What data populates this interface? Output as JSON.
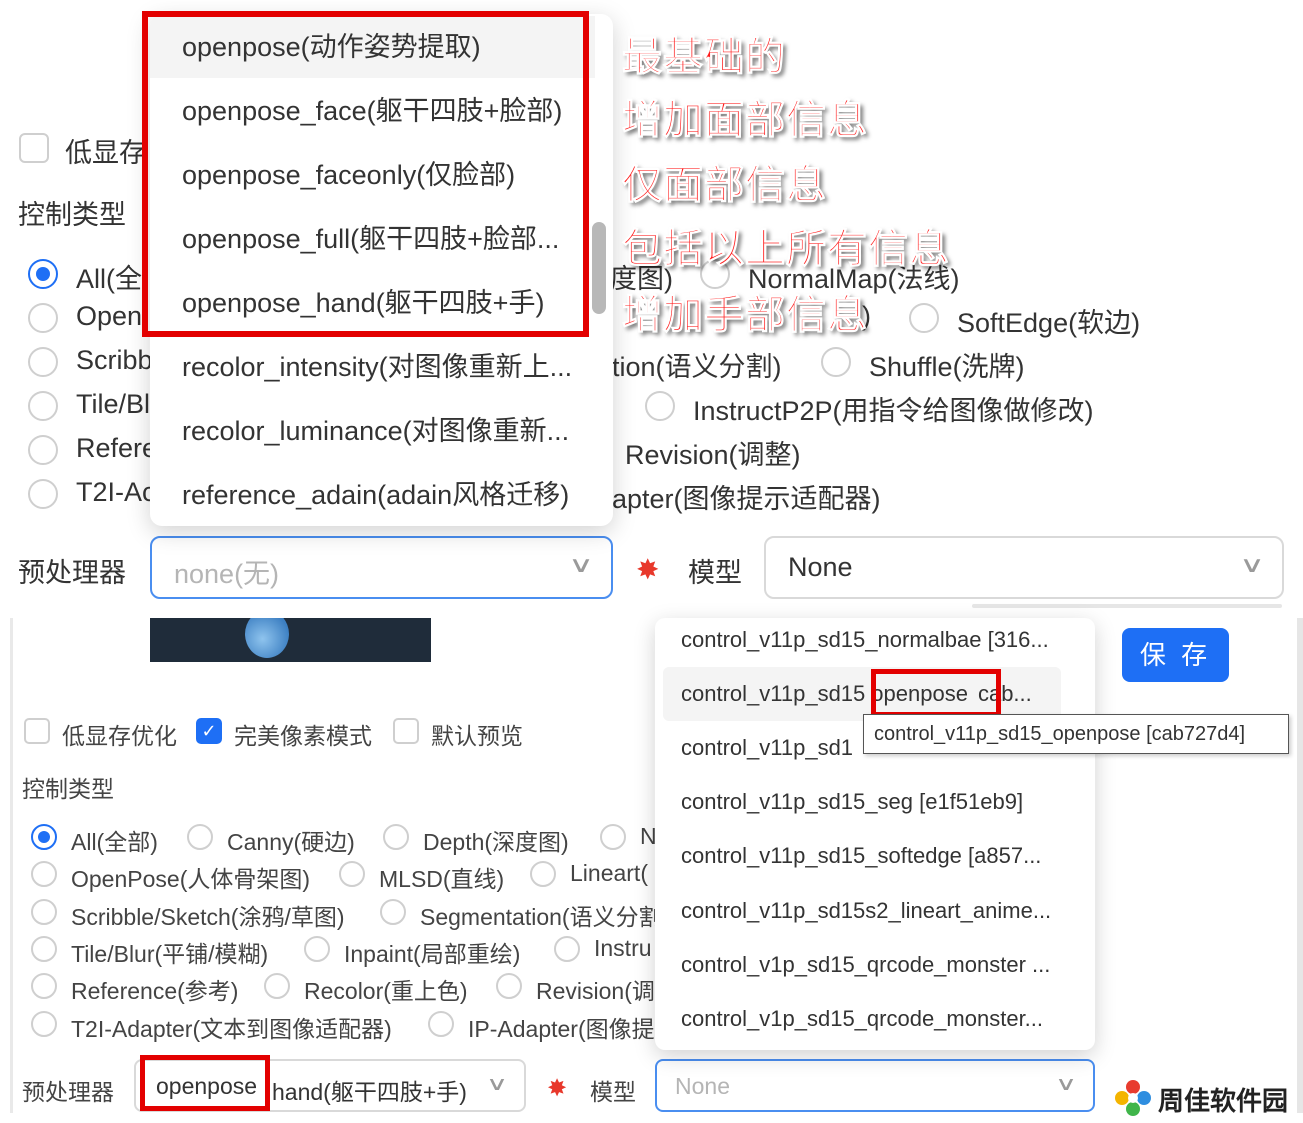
{
  "top": {
    "low_vram_label": "低显存",
    "control_type_label": "控制类型",
    "radios_left": [
      "All(全",
      "Open",
      "Scribb",
      "Tile/Bl",
      "Refere",
      "T2I-Ac"
    ],
    "radios_right": {
      "row1_prefix": "度图)",
      "row1_item": "NormalMap(法线)",
      "row2_prefix": ")",
      "row2_item": "SoftEdge(软边)",
      "row3_prefix": "tion(语义分割)",
      "row3_item": "Shuffle(洗牌)",
      "row4_item": "InstructP2P(用指令给图像做修改)",
      "row5_item": "Revision(调整)",
      "row6_prefix": "apter(图像提示适配器)"
    },
    "preprocessor_label": "预处理器",
    "preprocessor_value": "none(无)",
    "model_label": "模型",
    "model_value": "None",
    "dropdown_items": [
      "openpose(动作姿势提取)",
      "openpose_face(躯干四肢+脸部)",
      "openpose_faceonly(仅脸部)",
      "openpose_full(躯干四肢+脸部...",
      "openpose_hand(躯干四肢+手)",
      "recolor_intensity(对图像重新上...",
      "recolor_luminance(对图像重新...",
      "reference_adain(adain风格迁移)"
    ],
    "notes": [
      "最基础的",
      "增加面部信息",
      "仅面部信息",
      "包括以上所有信息",
      "增加手部信息"
    ]
  },
  "bottom": {
    "checkboxes": [
      {
        "label": "低显存优化",
        "checked": false
      },
      {
        "label": "完美像素模式",
        "checked": true
      },
      {
        "label": "默认预览",
        "checked": false
      }
    ],
    "checkmark": "✓",
    "control_type_label": "控制类型",
    "radio_rows": [
      [
        "All(全部)",
        "Canny(硬边)",
        "Depth(深度图)",
        "N"
      ],
      [
        "OpenPose(人体骨架图)",
        "MLSD(直线)",
        "Lineart(",
        ""
      ],
      [
        "Scribble/Sketch(涂鸦/草图)",
        "Segmentation(语义分割",
        "",
        ""
      ],
      [
        "Tile/Blur(平铺/模糊)",
        "Inpaint(局部重绘)",
        "Instru",
        ""
      ],
      [
        "Reference(参考)",
        "Recolor(重上色)",
        "Revision(调",
        ""
      ],
      [
        "T2I-Adapter(文本到图像适配器)",
        "IP-Adapter(图像提",
        "",
        ""
      ]
    ],
    "preprocessor_label": "预处理器",
    "preprocessor_value_a": "openpose",
    "preprocessor_value_b": "hand(躯干四肢+手)",
    "model_label": "模型",
    "model_value": "None",
    "save_label": "保 存",
    "model_items": [
      "control_v11p_sd15_normalbae [316...",
      "control_v11p_sd15",
      "control_v11p_sd1",
      "control_v11p_sd15_seg [e1f51eb9]",
      "control_v11p_sd15_softedge [a857...",
      "control_v11p_sd15s2_lineart_anime...",
      "control_v1p_sd15_qrcode_monster ...",
      "control_v1p_sd15_qrcode_monster..."
    ],
    "model_item2_highlight": "openpose",
    "model_item2_tail": "cab...",
    "tooltip": "control_v11p_sd15_openpose [cab727d4]",
    "logo_text": "周佳软件园"
  },
  "colors": {
    "accent": "#1e6ff5",
    "annotation_red": "#e30000"
  }
}
